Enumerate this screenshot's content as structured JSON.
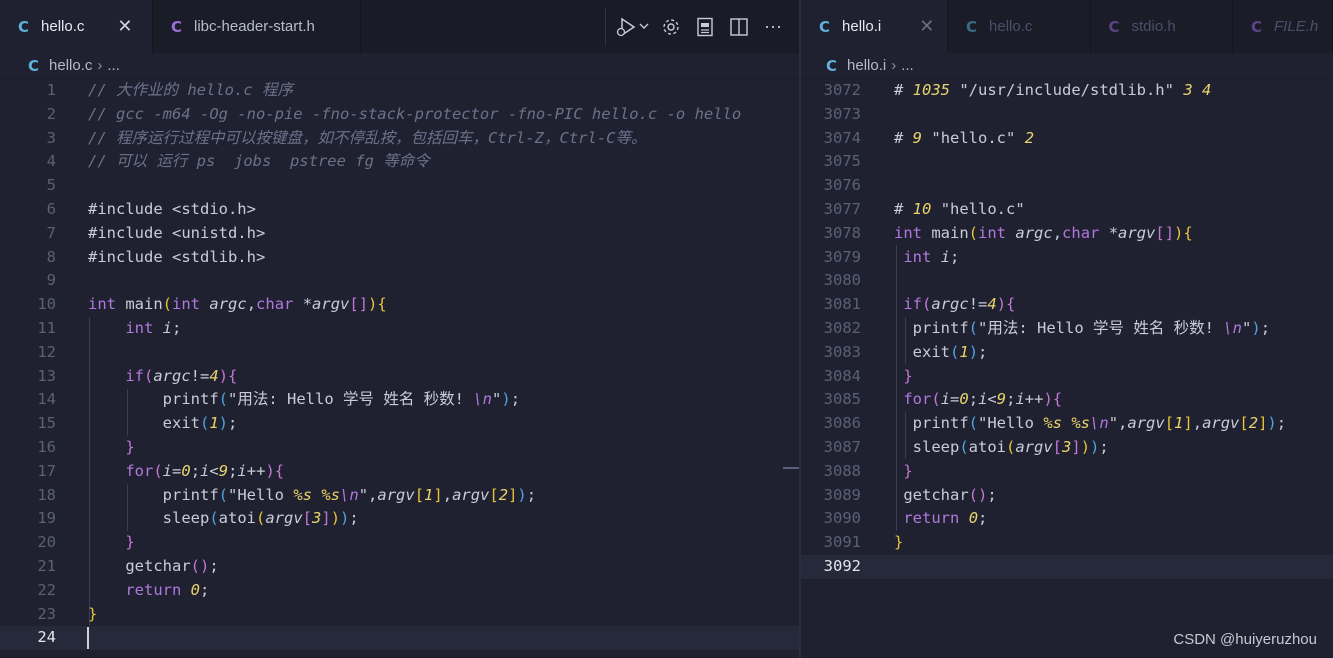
{
  "left": {
    "tabs": [
      {
        "label": "hello.c",
        "icon": "C",
        "active": true
      },
      {
        "label": "libc-header-start.h",
        "icon": "C",
        "active": false
      }
    ],
    "breadcrumb": {
      "file": "hello.c",
      "rest": "..."
    },
    "line_numbers": [
      "1",
      "2",
      "3",
      "4",
      "5",
      "6",
      "7",
      "8",
      "9",
      "10",
      "11",
      "12",
      "13",
      "14",
      "15",
      "16",
      "17",
      "18",
      "19",
      "20",
      "21",
      "22",
      "23",
      "24"
    ],
    "comments": {
      "l1": "// 大作业的 hello.c 程序",
      "l2": "// gcc -m64 -Og -no-pie -fno-stack-protector -fno-PIC hello.c -o hello",
      "l3": "// 程序运行过程中可以按键盘，如不停乱按，包括回车，Ctrl-Z，Ctrl-C等。",
      "l4": "// 可以 运行 ps  jobs  pstree fg 等命令"
    },
    "includes": [
      "#include <stdio.h>",
      "#include <unistd.h>",
      "#include <stdlib.h>"
    ],
    "usage_string": "\"用法: Hello 学号 姓名 秒数! ",
    "hello_string": "\"Hello ",
    "current_line": "24"
  },
  "right": {
    "tabs": [
      {
        "label": "hello.i",
        "icon": "C",
        "active": true
      },
      {
        "label": "hello.c",
        "icon": "C",
        "active": false
      },
      {
        "label": "stdio.h",
        "icon": "C",
        "active": false
      },
      {
        "label": "FILE.h",
        "icon": "C",
        "active": false
      }
    ],
    "breadcrumb": {
      "file": "hello.i",
      "rest": "..."
    },
    "line_numbers": [
      "3072",
      "3073",
      "3074",
      "3075",
      "3076",
      "3077",
      "3078",
      "3079",
      "3080",
      "3081",
      "3082",
      "3083",
      "3084",
      "3085",
      "3086",
      "3087",
      "3088",
      "3089",
      "3090",
      "3091",
      "3092"
    ],
    "directives": {
      "l3072_num": "1035",
      "l3072_path": "\"/usr/include/stdlib.h\"",
      "l3072_flags": "3 4",
      "l3074_num": "9",
      "l3074_path": "\"hello.c\"",
      "l3074_flag": "2",
      "l3077_num": "10",
      "l3077_path": "\"hello.c\""
    },
    "current_line": "3092"
  },
  "icons": {
    "run": "run-debug-icon",
    "settings": "gear-icon",
    "preview": "open-preview-icon",
    "split": "split-editor-icon",
    "more": "more-actions-icon"
  },
  "watermark": "CSDN @huiyeruzhou",
  "colors": {
    "background": "#1f2130",
    "keyword": "#b078dc",
    "number": "#e8d36a",
    "comment": "#6c718a",
    "c_icon": "#62b0d8",
    "h_icon": "#9b6fd8"
  }
}
